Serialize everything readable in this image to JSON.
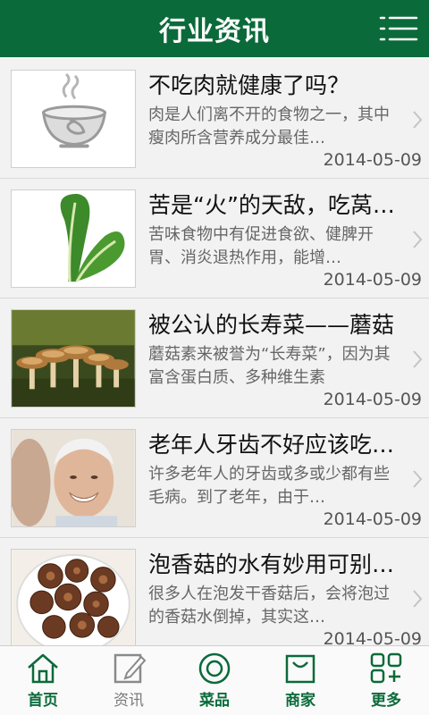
{
  "header": {
    "title": "行业资讯",
    "menu_icon": "menu-list-icon"
  },
  "articles": [
    {
      "title": "不吃肉就健康了吗？",
      "summary": "肉是人们离不开的食物之一，其中瘦肉所含营养成分最佳…",
      "date": "2014-05-09",
      "thumb": "bowl-placeholder-icon"
    },
    {
      "title": "苦是“火”的天敌，吃莴…",
      "summary": "苦味食物中有促进食欲、健脾开胃、消炎退热作用，能增…",
      "date": "2014-05-09",
      "thumb": "lettuce-photo"
    },
    {
      "title": "被公认的长寿菜——蘑菇",
      "summary": "蘑菇素来被誉为“长寿菜”，因为其富含蛋白质、多种维生素",
      "date": "2014-05-09",
      "thumb": "mushrooms-photo"
    },
    {
      "title": "老年人牙齿不好应该吃…",
      "summary": "许多老年人的牙齿或多或少都有些毛病。到了老年，由于…",
      "date": "2014-05-09",
      "thumb": "elderly-man-photo"
    },
    {
      "title": "泡香菇的水有妙用可别…",
      "summary": "很多人在泡发干香菇后，会将泡过的香菇水倒掉，其实这…",
      "date": "2014-05-09",
      "thumb": "shiitake-bowl-photo"
    }
  ],
  "tabs": [
    {
      "label": "首页",
      "icon": "home-icon",
      "active": true
    },
    {
      "label": "资讯",
      "icon": "news-edit-icon",
      "active": false
    },
    {
      "label": "菜品",
      "icon": "dish-circle-icon",
      "active": true
    },
    {
      "label": "商家",
      "icon": "shopping-bag-icon",
      "active": true
    },
    {
      "label": "更多",
      "icon": "more-grid-icon",
      "active": true
    }
  ],
  "colors": {
    "brand": "#0a6a3a",
    "background": "#f2f2f2",
    "inactive": "#7a7a7a"
  }
}
